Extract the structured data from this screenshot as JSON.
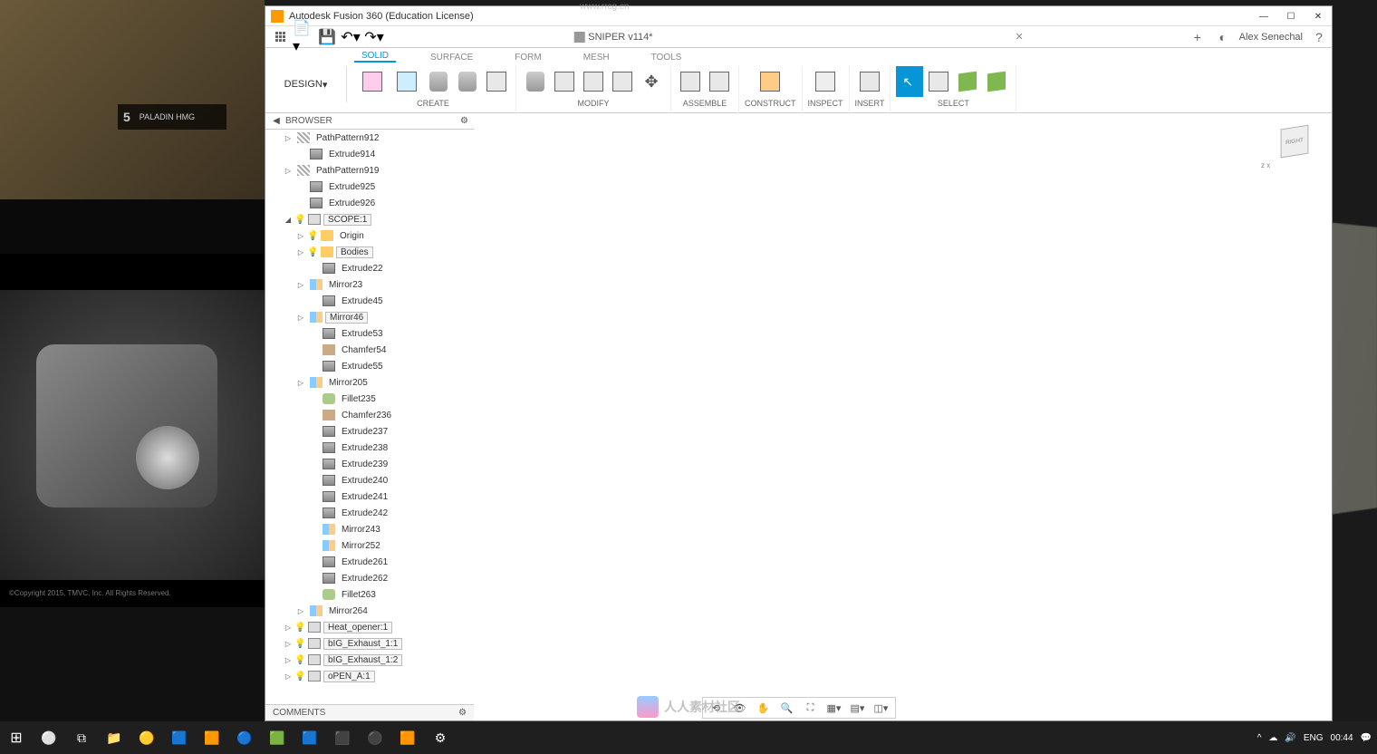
{
  "watermark_url": "www.rrcg.cn",
  "watermark_text": "人人素材社区",
  "reference": {
    "hud_number": "5",
    "hud_text": "PALADIN HMG",
    "copyright": "©Copyright 2015, TMVC, Inc. All Rights Reserved."
  },
  "fusion": {
    "title": "Autodesk Fusion 360 (Education License)",
    "document": "SNIPER v114*",
    "user": "Alex Senechal",
    "workspace": "DESIGN",
    "tabs": [
      "SOLID",
      "SURFACE",
      "FORM",
      "MESH",
      "TOOLS"
    ],
    "active_tab": "SOLID",
    "ribbon_groups": [
      "CREATE",
      "MODIFY",
      "ASSEMBLE",
      "CONSTRUCT",
      "INSPECT",
      "INSERT",
      "SELECT"
    ],
    "browser_title": "BROWSER",
    "comments_title": "COMMENTS",
    "viewcube_face": "RIGHT",
    "viewcube_axes": "z   x",
    "tree": [
      {
        "indent": 20,
        "tri": "▷",
        "ico": "patt",
        "label": "PathPattern912"
      },
      {
        "indent": 34,
        "ico": "ext",
        "label": "Extrude914"
      },
      {
        "indent": 20,
        "tri": "▷",
        "ico": "patt",
        "label": "PathPattern919"
      },
      {
        "indent": 34,
        "ico": "ext",
        "label": "Extrude925"
      },
      {
        "indent": 34,
        "ico": "ext",
        "label": "Extrude926"
      },
      {
        "indent": 20,
        "tri": "◢",
        "bulb": true,
        "ico": "comp",
        "label": "SCOPE:1",
        "boxed": true
      },
      {
        "indent": 34,
        "tri": "▷",
        "bulb": true,
        "ico": "fold",
        "label": "Origin"
      },
      {
        "indent": 34,
        "tri": "▷",
        "bulb": true,
        "ico": "fold",
        "label": "Bodies",
        "boxed": true
      },
      {
        "indent": 48,
        "ico": "ext",
        "label": "Extrude22"
      },
      {
        "indent": 34,
        "tri": "▷",
        "ico": "mir",
        "label": "Mirror23"
      },
      {
        "indent": 48,
        "ico": "ext",
        "label": "Extrude45"
      },
      {
        "indent": 34,
        "tri": "▷",
        "ico": "mir",
        "label": "Mirror46",
        "boxed": true
      },
      {
        "indent": 48,
        "ico": "ext",
        "label": "Extrude53"
      },
      {
        "indent": 48,
        "ico": "cham",
        "label": "Chamfer54"
      },
      {
        "indent": 48,
        "ico": "ext",
        "label": "Extrude55"
      },
      {
        "indent": 34,
        "tri": "▷",
        "ico": "mir",
        "label": "Mirror205"
      },
      {
        "indent": 48,
        "ico": "fil",
        "label": "Fillet235"
      },
      {
        "indent": 48,
        "ico": "cham",
        "label": "Chamfer236"
      },
      {
        "indent": 48,
        "ico": "ext",
        "label": "Extrude237"
      },
      {
        "indent": 48,
        "ico": "ext",
        "label": "Extrude238"
      },
      {
        "indent": 48,
        "ico": "ext",
        "label": "Extrude239"
      },
      {
        "indent": 48,
        "ico": "ext",
        "label": "Extrude240"
      },
      {
        "indent": 48,
        "ico": "ext",
        "label": "Extrude241"
      },
      {
        "indent": 48,
        "ico": "ext",
        "label": "Extrude242"
      },
      {
        "indent": 48,
        "ico": "mir",
        "label": "Mirror243"
      },
      {
        "indent": 48,
        "ico": "mir",
        "label": "Mirror252"
      },
      {
        "indent": 48,
        "ico": "ext",
        "label": "Extrude261"
      },
      {
        "indent": 48,
        "ico": "ext",
        "label": "Extrude262"
      },
      {
        "indent": 48,
        "ico": "fil",
        "label": "Fillet263"
      },
      {
        "indent": 34,
        "tri": "▷",
        "ico": "mir",
        "label": "Mirror264"
      },
      {
        "indent": 20,
        "tri": "▷",
        "bulb": true,
        "ico": "comp",
        "label": "Heat_opener:1",
        "boxed": true
      },
      {
        "indent": 20,
        "tri": "▷",
        "bulb": true,
        "ico": "comp",
        "label": "bIG_Exhaust_1:1",
        "boxed": true
      },
      {
        "indent": 20,
        "tri": "▷",
        "bulb": true,
        "ico": "comp",
        "label": "bIG_Exhaust_1:2",
        "boxed": true
      },
      {
        "indent": 20,
        "tri": "▷",
        "bulb": true,
        "ico": "comp",
        "label": "oPEN_A:1",
        "boxed": true
      }
    ]
  },
  "taskbar": {
    "lang": "ENG",
    "time": "00:44"
  }
}
